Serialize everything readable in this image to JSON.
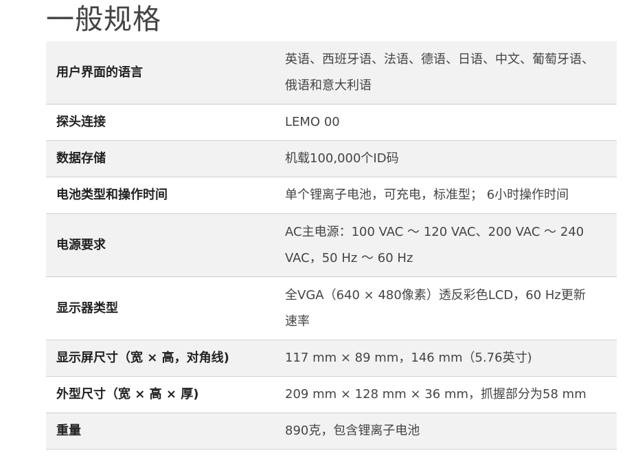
{
  "title": "一般规格",
  "specs": [
    {
      "label": "用户界面的语言",
      "value": "英语、西班牙语、法语、德语、日语、中文、葡萄牙语、俄语和意大利语"
    },
    {
      "label": "探头连接",
      "value": "LEMO 00"
    },
    {
      "label": "数据存储",
      "value": "机载100,000个ID码"
    },
    {
      "label": "电池类型和操作时间",
      "value": "单个锂离子电池，可充电，标准型； 6小时操作时间"
    },
    {
      "label": "电源要求",
      "value": "AC主电源：100 VAC ～ 120 VAC、200 VAC ～ 240 VAC，50 Hz ～ 60 Hz"
    },
    {
      "label": "显示器类型",
      "value": "全VGA（640 × 480像素）透反彩色LCD，60 Hz更新速率"
    },
    {
      "label": "显示屏尺寸（宽 × 高，对角线)",
      "value": "117 mm × 89 mm，146 mm（5.76英寸)"
    },
    {
      "label": "外型尺寸（宽 × 高 × 厚)",
      "value": "209 mm × 128 mm × 36 mm，抓握部分为58 mm"
    },
    {
      "label": "重量",
      "value": "890克，包含锂离子电池"
    }
  ]
}
